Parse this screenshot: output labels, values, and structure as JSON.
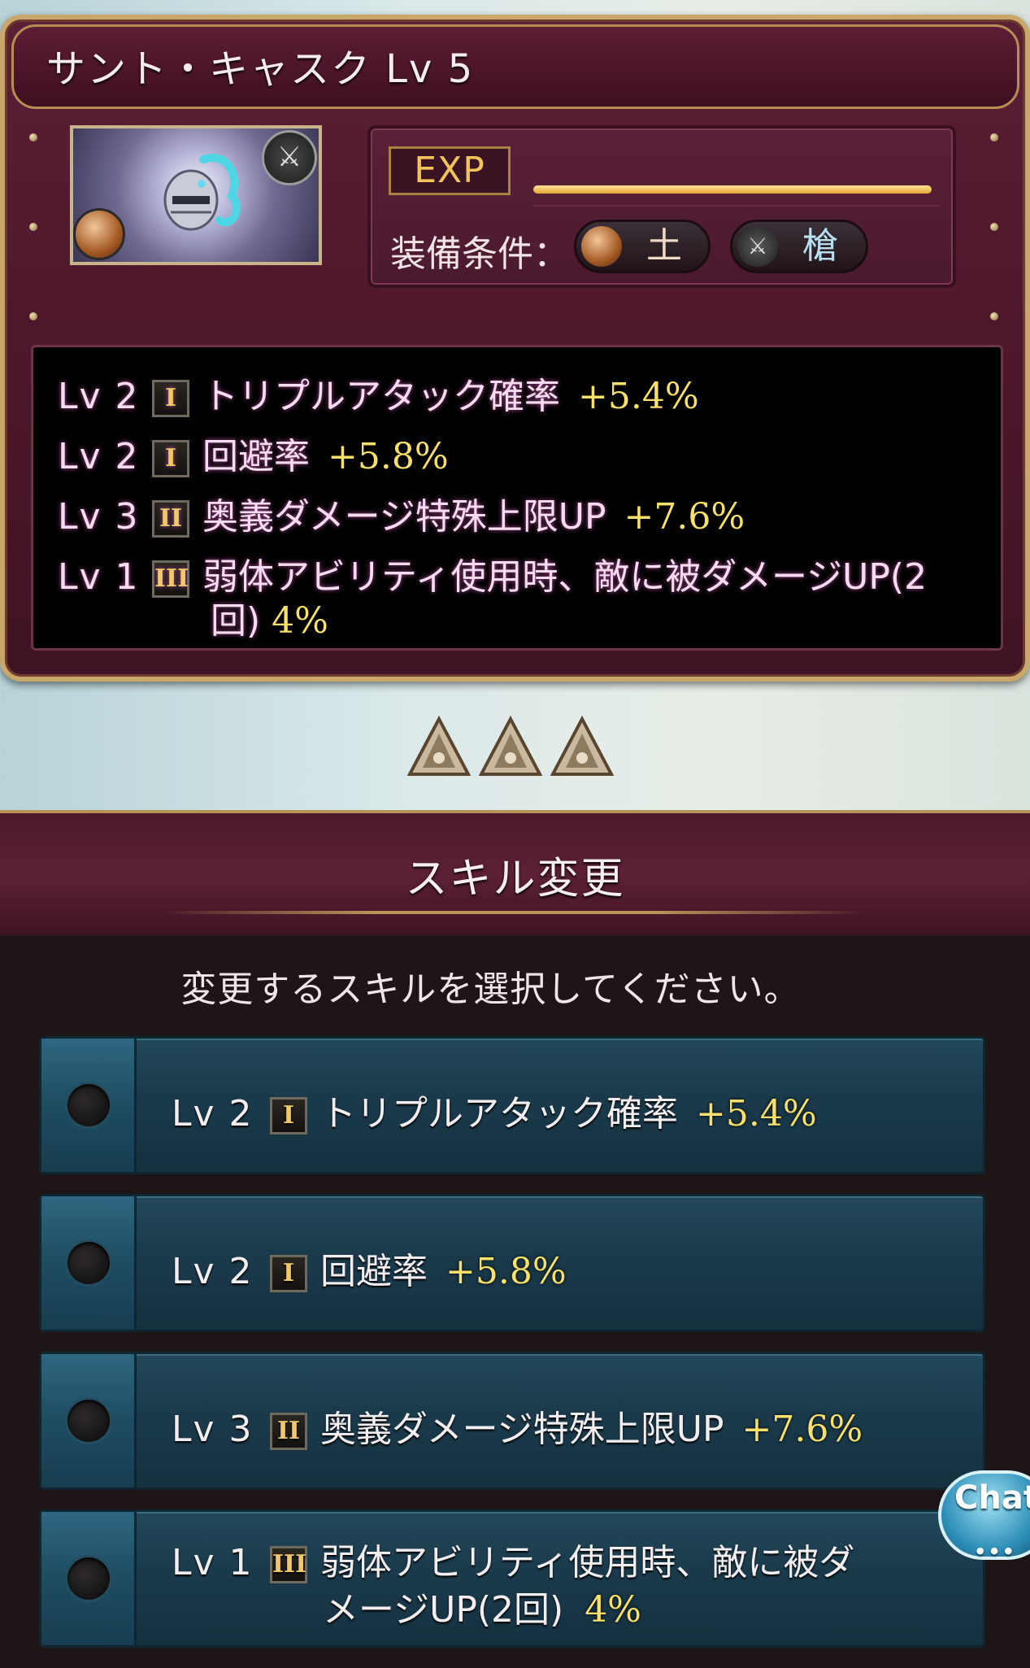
{
  "header": {
    "title": "サント・キャスク Lv 5"
  },
  "item": {
    "exp_label": "EXP",
    "exp_progress": 1.0,
    "requirement_label": "装備条件：",
    "element": "土",
    "weapon": "槍"
  },
  "skills": [
    {
      "level": "Lv 2",
      "rank": "I",
      "name": "トリプルアタック確率",
      "value": "+5.4%"
    },
    {
      "level": "Lv 2",
      "rank": "I",
      "name": "回避率",
      "value": "+5.8%"
    },
    {
      "level": "Lv 3",
      "rank": "II",
      "name": "奥義ダメージ特殊上限UP",
      "value": "+7.6%"
    },
    {
      "level": "Lv 1",
      "rank": "III",
      "name": "弱体アビリティ使用時、敵に被ダメージUP(2",
      "name2": "回)",
      "value": "4%"
    }
  ],
  "skill_change": {
    "title": "スキル変更",
    "instruction": "変更するスキルを選択してください。",
    "options": [
      {
        "level": "Lv 2",
        "rank": "I",
        "name": "トリプルアタック確率",
        "value": "+5.4%"
      },
      {
        "level": "Lv 2",
        "rank": "I",
        "name": "回避率",
        "value": "+5.8%"
      },
      {
        "level": "Lv 3",
        "rank": "II",
        "name": "奥義ダメージ特殊上限UP",
        "value": "+7.6%"
      },
      {
        "level": "Lv 1",
        "rank": "III",
        "name": "弱体アビリティ使用時、敵に被ダ",
        "name2": "メージUP(2回)",
        "value": "4%"
      }
    ]
  },
  "chat_button": {
    "label": "Chat",
    "dots": "•••"
  },
  "colors": {
    "accent_gold": "#f8e06a",
    "panel_maroon": "#5c1f36",
    "option_teal": "#1a3a4b"
  }
}
